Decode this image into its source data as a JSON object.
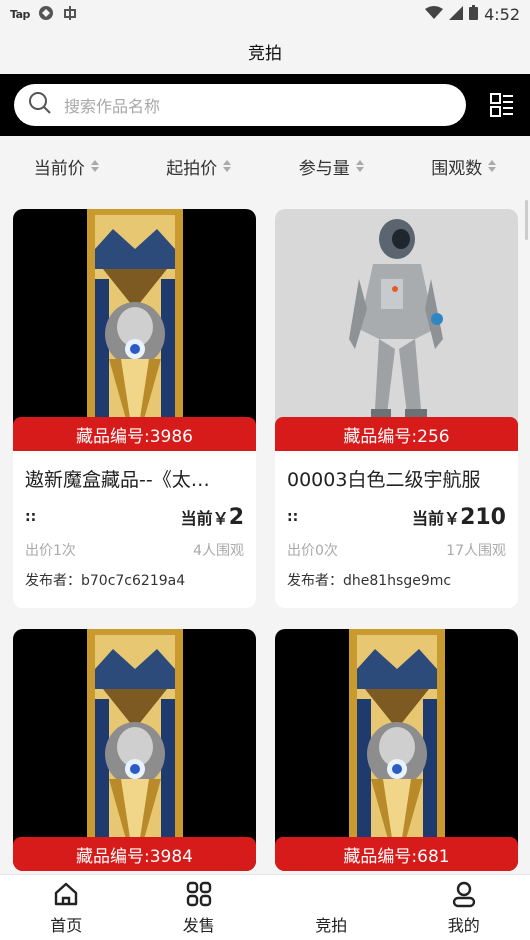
{
  "status": {
    "app": "Tap",
    "time": "4:52"
  },
  "header": {
    "title": "竞拍"
  },
  "search": {
    "placeholder": "搜索作品名称"
  },
  "sort": [
    {
      "label": "当前价"
    },
    {
      "label": "起拍价"
    },
    {
      "label": "参与量"
    },
    {
      "label": "围观数"
    }
  ],
  "items": [
    {
      "tag": "藏品编号:3986",
      "name": "遨新魔盒藏品--《太…",
      "dots": "::",
      "price_label": "当前￥",
      "price": "2",
      "bids": "出价1次",
      "views": "4人围观",
      "publisher": "发布者：b70c7c6219a4",
      "image": "mecha-warrior-banner"
    },
    {
      "tag": "藏品编号:256",
      "name": "00003白色二级宇航服",
      "dots": "::",
      "price_label": "当前￥",
      "price": "210",
      "bids": "出价0次",
      "views": "17人围观",
      "publisher": "发布者：dhe81hsge9mc",
      "image": "astronaut-figure"
    },
    {
      "tag": "藏品编号:3984",
      "image": "mecha-warrior-banner"
    },
    {
      "tag": "藏品编号:681",
      "image": "mecha-warrior-banner"
    }
  ],
  "tabs": [
    {
      "label": "首页",
      "icon": "home-icon"
    },
    {
      "label": "发售",
      "icon": "grid-icon"
    },
    {
      "label": "竞拍",
      "icon": "auction-icon"
    },
    {
      "label": "我的",
      "icon": "user-icon"
    }
  ]
}
